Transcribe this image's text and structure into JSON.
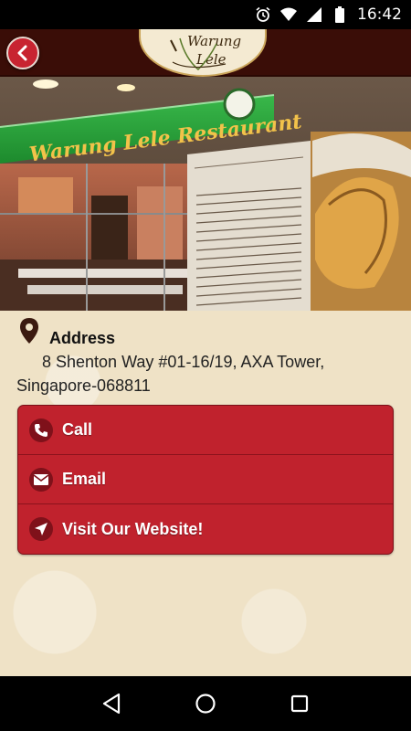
{
  "status_bar": {
    "time": "16:42",
    "icons": [
      "alarm-icon",
      "wifi-icon",
      "signal-icon",
      "battery-icon"
    ]
  },
  "header": {
    "back_icon": "chevron-left-icon",
    "logo_text": "Warung Lele",
    "colors": {
      "bar": "#3a0d07",
      "back_button": "#c82431"
    }
  },
  "hero": {
    "sign_text": "Warung Lele Restaurant"
  },
  "address": {
    "title": "Address",
    "text": "8 Shenton Way #01-16/19, AXA Tower, Singapore-068811",
    "icon": "map-pin-icon"
  },
  "actions": [
    {
      "label": "Call",
      "icon": "phone-icon"
    },
    {
      "label": "Email",
      "icon": "envelope-icon"
    },
    {
      "label": "Visit Our Website!",
      "icon": "navigation-arrow-icon"
    }
  ],
  "accent_color": "#c0222d",
  "nav_bar": {
    "icons": [
      "back-triangle-icon",
      "home-circle-icon",
      "recents-square-icon"
    ]
  }
}
